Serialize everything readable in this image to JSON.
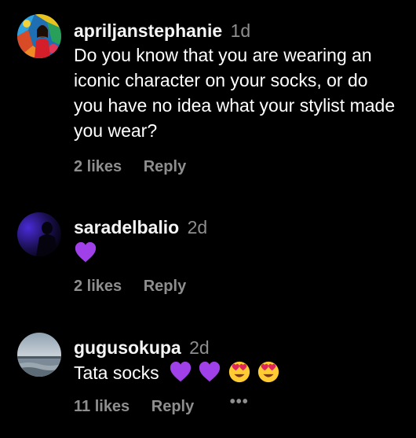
{
  "colors": {
    "background": "#000000",
    "text": "#ffffff",
    "muted": "#8e8e8e",
    "heart": "#a040e8"
  },
  "comments": [
    {
      "username": "apriljanstephanie",
      "time": "1d",
      "text": "Do you know that you are wearing an iconic character on your socks, or do you have no idea what your stylist made you wear?",
      "likes": "2 likes",
      "reply": "Reply",
      "avatar": "avatar-colorful-mural"
    },
    {
      "username": "saradelbalio",
      "time": "2d",
      "text": "",
      "emojis": [
        "purple-heart-emoji"
      ],
      "likes": "2 likes",
      "reply": "Reply",
      "avatar": "avatar-dark-purple"
    },
    {
      "username": "gugusokupa",
      "time": "2d",
      "text": "Tata socks",
      "emojis": [
        "purple-heart-emoji",
        "purple-heart-emoji",
        "heart-eyes-emoji",
        "heart-eyes-emoji"
      ],
      "likes": "11 likes",
      "reply": "Reply",
      "more": "•••",
      "avatar": "avatar-seascape"
    }
  ]
}
